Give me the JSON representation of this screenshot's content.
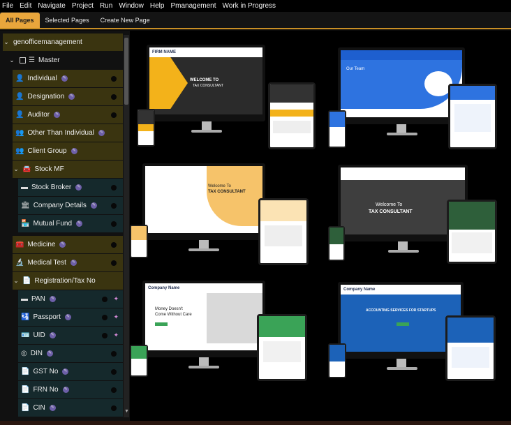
{
  "menubar": {
    "items": [
      "File",
      "Edit",
      "Navigate",
      "Project",
      "Run",
      "Window",
      "Help",
      "Pmanagement",
      "Work in Progress"
    ]
  },
  "tabs": [
    {
      "label": "All Pages",
      "active": true
    },
    {
      "label": "Selected Pages"
    },
    {
      "label": "Create New Page"
    }
  ],
  "tree": {
    "root": "genofficemanagement",
    "master": "Master",
    "items": [
      {
        "label": "Individual",
        "icon": "user-icon"
      },
      {
        "label": "Designation",
        "icon": "user-tie-icon"
      },
      {
        "label": "Auditor",
        "icon": "user-icon"
      },
      {
        "label": "Other Than Individual",
        "icon": "users-icon"
      },
      {
        "label": "Client Group",
        "icon": "users-icon"
      },
      {
        "label": "Stock MF",
        "icon": "car-icon"
      },
      {
        "label": "Stock Broker",
        "icon": "card-icon"
      },
      {
        "label": "Company Details",
        "icon": "bank-icon"
      },
      {
        "label": "Mutual Fund",
        "icon": "store-icon"
      },
      {
        "label": "Medicine",
        "icon": "medkit-icon"
      },
      {
        "label": "Medical Test",
        "icon": "microscope-icon"
      },
      {
        "label": "Registration/Tax No",
        "icon": "file-icon"
      },
      {
        "label": "PAN",
        "icon": "card-icon"
      },
      {
        "label": "Passport",
        "icon": "passport-icon"
      },
      {
        "label": "UID",
        "icon": "id-icon"
      },
      {
        "label": "DIN",
        "icon": "globe-icon"
      },
      {
        "label": "GST No",
        "icon": "file-icon"
      },
      {
        "label": "FRN No",
        "icon": "file-icon"
      },
      {
        "label": "CIN",
        "icon": "file-icon"
      }
    ]
  },
  "thumbnails": [
    {
      "logo": "FIRM NAME",
      "tagline": "TAX CONSULTANT",
      "hero": "WELCOME TO",
      "hero2": "TAX CONSULTANT",
      "theme": "#f3b21a"
    },
    {
      "logo": "",
      "tagline": "",
      "hero": "Our Team",
      "hero2": "",
      "theme": "#2e73e0"
    },
    {
      "logo": "",
      "tagline": "",
      "hero": "Welcome To",
      "hero2": "TAX CONSULTANT",
      "theme": "#f6c36a"
    },
    {
      "logo": "",
      "tagline": "",
      "hero": "Welcome To",
      "hero2": "TAX CONSULTANT",
      "theme": "#2e5f3a"
    },
    {
      "logo": "Company Name",
      "tagline": "",
      "hero": "Money Doesn't",
      "hero2": "Come Without Care",
      "theme": "#3aa357"
    },
    {
      "logo": "Company Name",
      "tagline": "",
      "hero": "ACCOUNTING SERVICES FOR STARTUPS",
      "hero2": "",
      "theme": "#1c62b8"
    }
  ]
}
